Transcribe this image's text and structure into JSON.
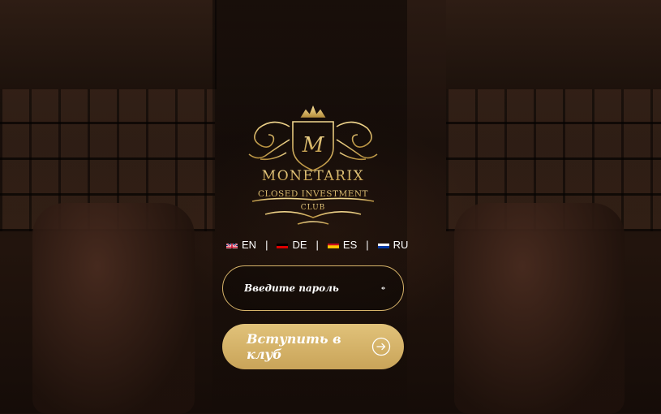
{
  "brand": {
    "name": "MONETARIX",
    "tagline": "CLOSED INVESTMENT",
    "tagline2": "CLUB",
    "monogram": "M",
    "gold": "#d7b46a"
  },
  "languages": [
    {
      "code": "EN",
      "flag": "uk-flag-icon"
    },
    {
      "code": "DE",
      "flag": "germany-flag-icon"
    },
    {
      "code": "ES",
      "flag": "spain-flag-icon"
    },
    {
      "code": "RU",
      "flag": "russia-flag-icon"
    }
  ],
  "separator": "|",
  "login": {
    "password_placeholder": "Введите пароль",
    "toggle_icon": "eye-icon",
    "submit_label": "Вступить в клуб",
    "submit_icon": "arrow-right-circle-icon"
  },
  "colors": {
    "accent": "#d7b46a",
    "button": "#d4b36b",
    "text": "#ffffff"
  }
}
